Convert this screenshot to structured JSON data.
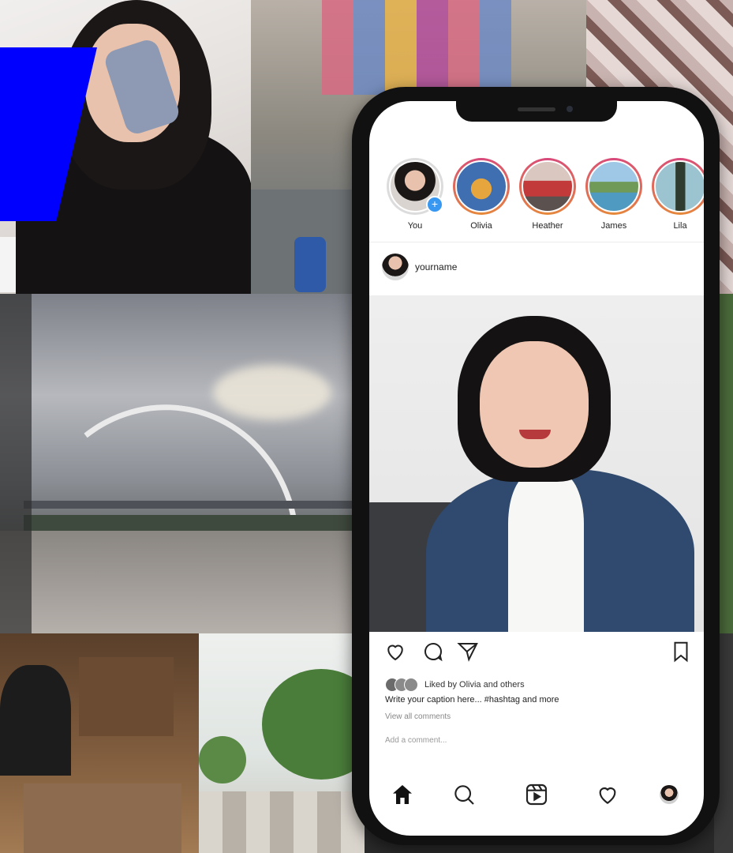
{
  "stories": [
    {
      "label": "You",
      "own": true,
      "add_badge": "+",
      "color": "#d9d4cf"
    },
    {
      "label": "Olivia",
      "own": false,
      "color": "#3f6fb0"
    },
    {
      "label": "Heather",
      "own": false,
      "color": "#c23b3a"
    },
    {
      "label": "James",
      "own": false,
      "color": "#4f9ac1"
    },
    {
      "label": "Lila",
      "own": false,
      "color": "#2e3b2e"
    }
  ],
  "post": {
    "username": "yourname",
    "liked_by": "Liked by Olivia and others",
    "caption": "Write your caption here... #hashtag and more",
    "view_comments": "View all comments",
    "add_comment": "Add a comment..."
  },
  "icons": {
    "like": "heart-icon",
    "comment": "comment-icon",
    "share": "send-icon",
    "save": "bookmark-icon",
    "home": "home-icon",
    "search": "search-icon",
    "reels": "reels-icon",
    "activity": "heart-icon"
  },
  "colors": {
    "highlight": "#0000ff",
    "story_ring": "#d8497c",
    "add_badge": "#3897f0"
  }
}
